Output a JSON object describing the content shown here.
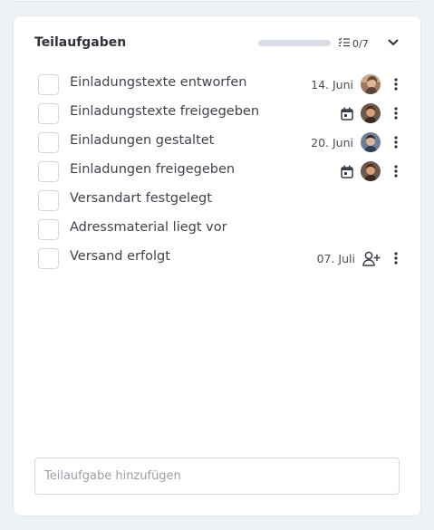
{
  "panel": {
    "title": "Teilaufgaben",
    "progress_fraction": 0,
    "count_text": "0/7",
    "accent_color": "#4c8df6"
  },
  "tasks": [
    {
      "label": "Einladungstexte entworfen",
      "date": "14. Juni",
      "assignee": "avatar-1",
      "calendar": false,
      "add_user": false,
      "menu": true
    },
    {
      "label": "Einladungstexte freigegeben",
      "date": "",
      "assignee": "avatar-2",
      "calendar": true,
      "add_user": false,
      "menu": true
    },
    {
      "label": "Einladungen gestaltet",
      "date": "20. Juni",
      "assignee": "avatar-3",
      "calendar": false,
      "add_user": false,
      "menu": true
    },
    {
      "label": "Einladungen freigegeben",
      "date": "",
      "assignee": "avatar-2",
      "calendar": true,
      "add_user": false,
      "menu": true
    },
    {
      "label": "Versandart festgelegt",
      "date": "",
      "assignee": "",
      "calendar": false,
      "add_user": false,
      "menu": false
    },
    {
      "label": "Adressmaterial liegt vor",
      "date": "",
      "assignee": "",
      "calendar": false,
      "add_user": false,
      "menu": false
    },
    {
      "label": "Versand erfolgt",
      "date": "07. Juli",
      "assignee": "",
      "calendar": false,
      "add_user": true,
      "menu": true
    }
  ],
  "add_task": {
    "placeholder": "Teilaufgabe hinzufügen"
  }
}
